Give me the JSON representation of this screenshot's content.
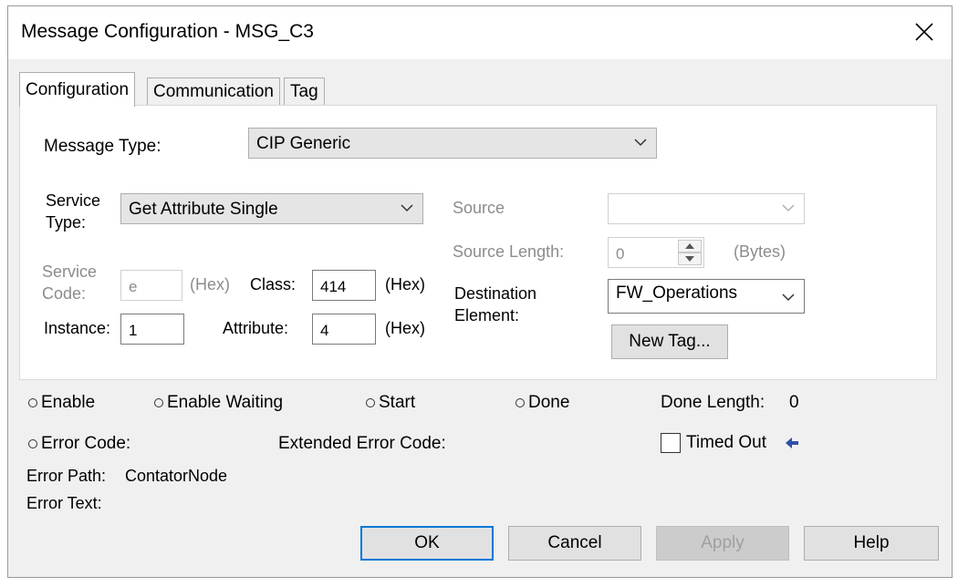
{
  "window": {
    "title": "Message Configuration - MSG_C3"
  },
  "tabs": [
    "Configuration",
    "Communication",
    "Tag"
  ],
  "config": {
    "message_type_label": "Message Type:",
    "message_type_value": "CIP Generic",
    "service_type_label_1": "Service",
    "service_type_label_2": "Type:",
    "service_type_value": "Get Attribute Single",
    "service_code_label_1": "Service",
    "service_code_label_2": "Code:",
    "service_code_value": "e",
    "hex_label": "(Hex)",
    "class_label": "Class:",
    "class_value": "414",
    "instance_label": "Instance:",
    "instance_value": "1",
    "attribute_label": "Attribute:",
    "attribute_value": "4",
    "source_label": "Source",
    "source_value": "",
    "source_length_label": "Source Length:",
    "source_length_value": "0",
    "bytes_label": "(Bytes)",
    "destination_label_1": "Destination",
    "destination_label_2": "Element:",
    "destination_value": "FW_Operations",
    "new_tag_label": "New Tag..."
  },
  "status": {
    "enable": "Enable",
    "enable_waiting": "Enable Waiting",
    "start": "Start",
    "done": "Done",
    "done_length_label": "Done Length:",
    "done_length_value": "0",
    "error_code_label": "Error Code:",
    "extended_error_code_label": "Extended Error Code:",
    "timed_out_label": "Timed Out",
    "error_path_label": "Error Path:",
    "error_path_value": "ContatorNode",
    "error_text_label": "Error Text:"
  },
  "buttons": {
    "ok": "OK",
    "cancel": "Cancel",
    "apply": "Apply",
    "help": "Help"
  },
  "colors": {
    "default_button_border": "#0078d7",
    "arrow_accent": "#2f4fa8"
  }
}
